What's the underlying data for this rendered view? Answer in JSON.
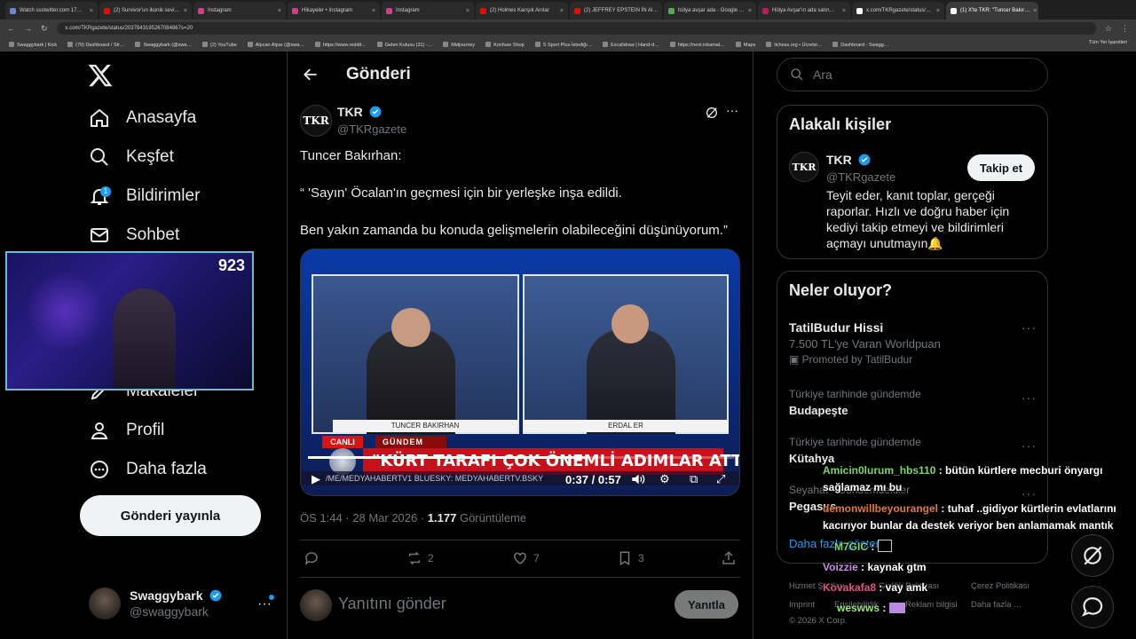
{
  "browser": {
    "tabs": [
      {
        "title": "Watch ssstwitter.com 17…",
        "color": "#6b86d6"
      },
      {
        "title": "(2) Survivor'un ikonik sevi…",
        "color": "#ff0000"
      },
      {
        "title": "Instagram",
        "color": "#d63b8a"
      },
      {
        "title": "Hikayeler • Instagram",
        "color": "#d63b8a"
      },
      {
        "title": "Instagram",
        "color": "#d63b8a"
      },
      {
        "title": "(2) Holmes Karışık Anılar",
        "color": "#ff0000"
      },
      {
        "title": "(2) JEFFREY EPSTEIN İN AI…",
        "color": "#ff0000"
      },
      {
        "title": "hülya avşar ada - Google …",
        "color": "#4caf50"
      },
      {
        "title": "Hülya Avşar'ın ada satın…",
        "color": "#c2185b"
      },
      {
        "title": "x.com/TKRgazete/status/…",
        "color": "#ffffff"
      },
      {
        "title": "(1) X'te TKR: \"Tuncer Bakır…",
        "color": "#ffffff"
      }
    ],
    "url": "x.com/TKRgazete/status/2037843195267084867s=20",
    "bookmarks": [
      "Swaggybark | Kick",
      "(79) Dashboard / Str…",
      "Swaggybark (@swa…",
      "(2) YouTube",
      "Alpcan Alpar (@swa…",
      "https://www.reddit…",
      "Gelen Kutusu (31) -…",
      "Midjourney",
      "Konfuse Shop",
      "S Sport Plus-İstediği…",
      "Excalidraw | Hand-d…",
      "https://next.inkamat…",
      "Maps",
      "lichess.org • Ücretsi…",
      "Dashboard - Swagg…"
    ],
    "bookmarks_right": "Tüm Yer İşaretleri"
  },
  "nav": {
    "items": [
      {
        "label": "Anasayfa",
        "icon": "home-icon"
      },
      {
        "label": "Keşfet",
        "icon": "search-icon"
      },
      {
        "label": "Bildirimler",
        "icon": "bell-icon",
        "badge": "1"
      },
      {
        "label": "Sohbet",
        "icon": "mail-icon"
      },
      {
        "label": "Makaleler",
        "icon": "article-icon"
      },
      {
        "label": "Profil",
        "icon": "profile-icon"
      },
      {
        "label": "Daha fazla",
        "icon": "more-circle-icon"
      }
    ],
    "post_button": "Gönderi yayınla",
    "user": {
      "name": "Swaggybark",
      "handle": "@swaggybark"
    }
  },
  "webcam": {
    "viewer_count": "923"
  },
  "post": {
    "header_title": "Gönderi",
    "author": {
      "name": "TKR",
      "handle": "@TKRgazete",
      "avatar_text": "TKR"
    },
    "lines": [
      "Tuncer Bakırhan:",
      "“ 'Sayın' Öcalan'ın geçmesi için bir yerleşke inşa edildi.",
      "Ben yakın zamanda bu konuda gelişmelerin olabileceğini düşünüyorum.”"
    ],
    "video": {
      "left_name": "TUNCER BAKIRHAN",
      "right_name": "ERDAL ER",
      "live": "CANLI",
      "section": "GÜNDEM",
      "headline": "\"KÜRT TARAFI ÇOK ÖNEMLİ ADIMLAR ATTI\"",
      "ticker": "/ME/MEDYAHABERTV1   BLUESKY: MEDYAHABERTV.BSKY",
      "time": "0:37 / 0:57",
      "progress": 0.65
    },
    "meta": {
      "time": "ÖS 1:44 · 28 Mar 2026 · ",
      "views": "1.177",
      "views_label": " Görüntüleme"
    },
    "actions": {
      "replies": "",
      "reposts": "2",
      "likes": "7",
      "bookmarks": "3"
    },
    "reply_placeholder": "Yanıtını gönder",
    "reply_button": "Yanıtla"
  },
  "sidebar": {
    "search_placeholder": "Ara",
    "related_title": "Alakalı kişiler",
    "related": {
      "name": "TKR",
      "handle": "@TKRgazete",
      "follow": "Takip et",
      "bio": "Teyit eder, kanıt toplar, gerçeği raporlar. Hızlı ve doğru haber için kediyi takip etmeyi ve bildirimleri açmayı unutmayın🔔"
    },
    "trends_title": "Neler oluyor?",
    "trends": [
      {
        "sub": "",
        "main": "TatilBudur Hissi",
        "extra": "7.500 TL'ye Varan Worldpuan",
        "promo": "Promoted by TatilBudur"
      },
      {
        "sub": "Türkiye tarihinde gündemde",
        "main": "Budapeşte"
      },
      {
        "sub": "Türkiye tarihinde gündemde",
        "main": "Kütahya"
      },
      {
        "sub": "Seyahat · Gündemdekiler",
        "main": "Pegasus"
      }
    ],
    "show_more": "Daha fazla göster",
    "footer": [
      "Hizmet Şartları",
      "Gizlilik Politikası",
      "Çerez Politikası",
      "Imprint",
      "Erişilebilirlik",
      "Reklam bilgisi",
      "Daha fazla …",
      "© 2026 X Corp."
    ]
  },
  "chat": [
    {
      "user": "Amicin0lurum_hbs110",
      "color": "#7fd56a",
      "msg": " : bütün kürtlere mecburi önyargı",
      "cont": "sağlamaz mı bu"
    },
    {
      "user": "demonwillbeyourangel",
      "color": "#e07a3a",
      "msg": " : tuhaf ..gidiyor kürtlerin evlatlarını",
      "cont": "kacırıyor bunlar da destek veriyor ben anlamamak mantık"
    },
    {
      "user": "M7GIC",
      "color": "#7fd56a",
      "msg": " : "
    },
    {
      "user": "Voizzie",
      "color": "#c98be6",
      "msg": " : kaynak gtm"
    },
    {
      "user": "Kovakafa8",
      "color": "#e0557f",
      "msg": " : vay amk"
    },
    {
      "user": "weswws",
      "color": "#9be67a",
      "msg": " : "
    }
  ]
}
